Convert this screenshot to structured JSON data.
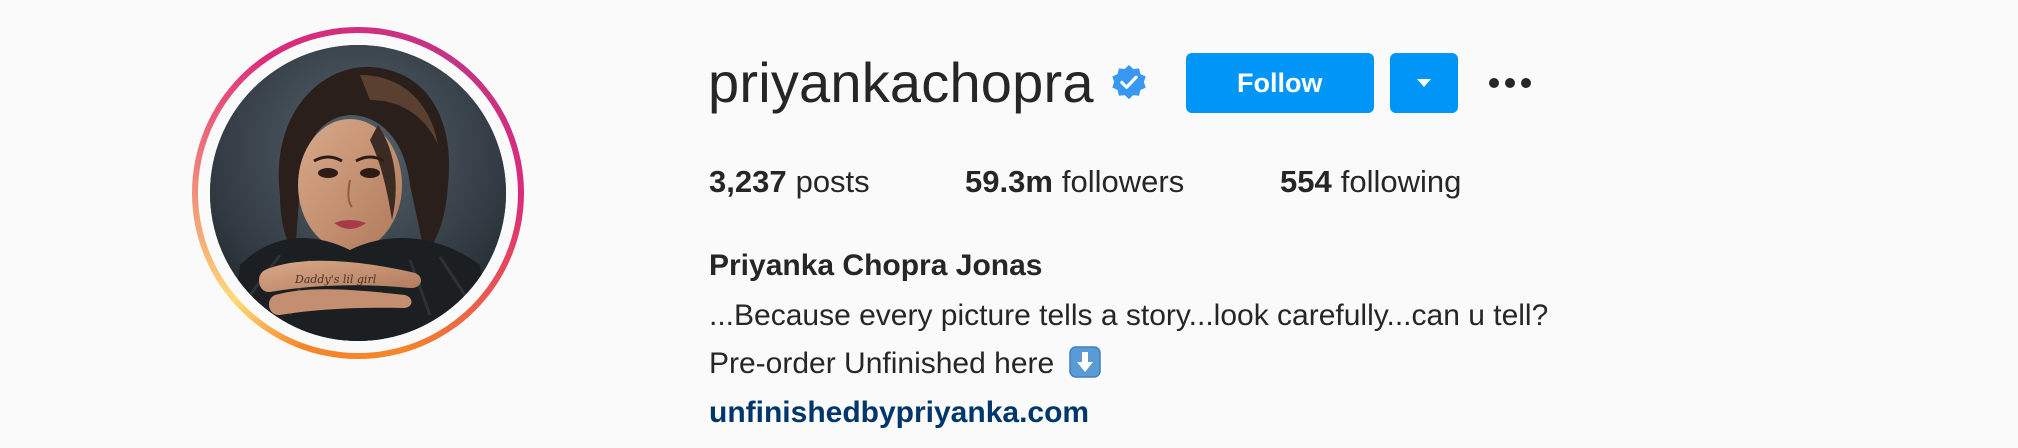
{
  "profile": {
    "username": "priyankachopra",
    "verified": true,
    "full_name": "Priyanka Chopra Jonas",
    "bio_lines": [
      "...Because every picture tells a story...look carefully...can u tell?",
      "Pre-order Unfinished here"
    ],
    "bio_emoji": "down-arrow-emoji",
    "link": "unfinishedbypriyanka.com"
  },
  "actions": {
    "follow_label": "Follow",
    "dropdown_icon": "chevron-down-icon",
    "more_icon": "more-options-icon"
  },
  "stats": {
    "posts_count": "3,237",
    "posts_label": "posts",
    "followers_count": "59.3m",
    "followers_label": "followers",
    "following_count": "554",
    "following_label": "following"
  },
  "colors": {
    "primary_button": "#0095f6",
    "link": "#00376b",
    "verified_badge": "#3897f0",
    "text": "#262626",
    "background": "#fafafa"
  }
}
